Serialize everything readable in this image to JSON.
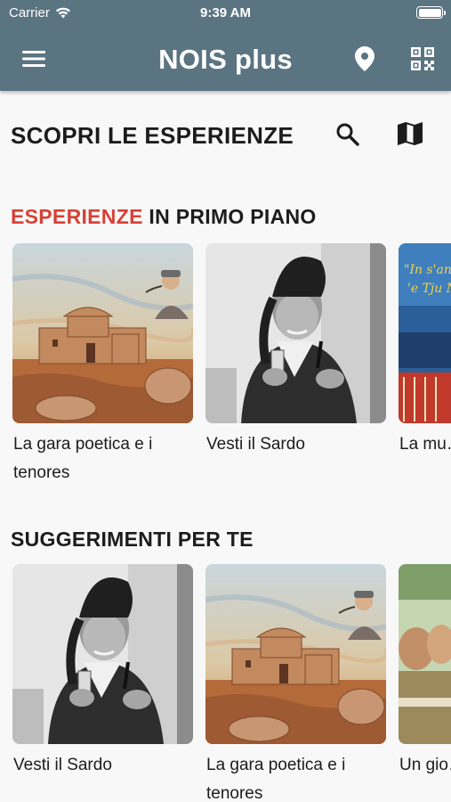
{
  "status_bar": {
    "carrier": "Carrier",
    "time": "9:39 AM"
  },
  "app_bar": {
    "title": "NOIS plus",
    "icons": [
      "menu-icon",
      "location-pin-icon",
      "qr-code-icon"
    ]
  },
  "discover": {
    "title": "SCOPRI LE ESPERIENZE",
    "icons": [
      "search-icon",
      "map-icon"
    ]
  },
  "featured": {
    "title_accent": "ESPERIENZE",
    "title_rest": " IN PRIMO PIANO",
    "items": [
      {
        "caption": "La gara poetica e i tenores"
      },
      {
        "caption": "Vesti il Sardo"
      },
      {
        "caption": "La mu… Nanne…"
      }
    ]
  },
  "suggestions": {
    "title": "SUGGERIMENTI PER TE",
    "items": [
      {
        "caption": "Vesti il Sardo"
      },
      {
        "caption": "La gara poetica e i tenores"
      },
      {
        "caption": "Un gio…"
      }
    ]
  },
  "colors": {
    "app_bar": "#5b7482",
    "accent": "#d64236",
    "background": "#f8f8f8"
  }
}
